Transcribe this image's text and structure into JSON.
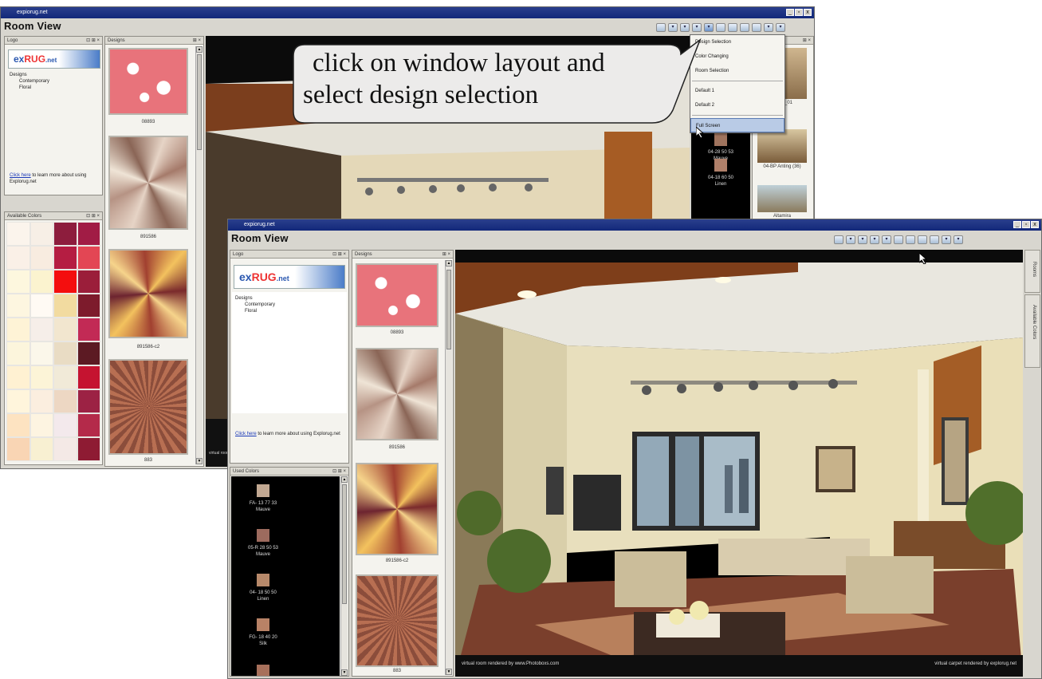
{
  "callout": {
    "line1": "click on window layout and",
    "line2": "select design selection"
  },
  "back_window": {
    "title": "expiorug.net",
    "app_title": "Room View",
    "logo_panel_title": "Logo",
    "designs_panel_title": "Designs",
    "colors_panel_title": "Available Colors",
    "tree": [
      "Designs",
      "Contemporary",
      "Floral"
    ],
    "link_prefix": "Click here",
    "link_text": " to learn more about using Explorug.net",
    "design_captions": [
      "08893",
      "891586",
      "891586-c2",
      "883"
    ],
    "menu_items": [
      "Design Selection",
      "Color Changing",
      "Room Selection",
      "Default 1",
      "Default 2",
      "Full Screen"
    ],
    "menu_highlight": "Full Screen",
    "right_color_items": [
      {
        "code": "04-28 50 53",
        "name": "Mauve",
        "color": "#a0745e"
      },
      {
        "code": "04-18 60 50",
        "name": "Linen",
        "color": "#b0806a"
      }
    ],
    "room_thumbs": [
      "Room_01",
      "04-BP Anting (36)",
      "Altamira"
    ],
    "room_footer_left": "virtual room rendered by www.Photoboxs.com",
    "swatch_colors": [
      "#fbf4ec",
      "#f7efe6",
      "#8d1d3d",
      "#a11c45",
      "#faf0e7",
      "#f8ece0",
      "#b51d42",
      "#e34654",
      "#fdf7de",
      "#fbf3cf",
      "#f40e0e",
      "#9b1e3a",
      "#fdf6e0",
      "#fffaf4",
      "#f2dba0",
      "#7d1b2c",
      "#fef3d6",
      "#f6eee9",
      "#f2e6cf",
      "#c22a55",
      "#fcf5dc",
      "#fbf7ea",
      "#e9dcc4",
      "#5c1a23",
      "#fff1d2",
      "#fcf4d7",
      "#f1ead8",
      "#c51330",
      "#fff5dc",
      "#fbeedf",
      "#edd7c3",
      "#9c2244",
      "#fde3c1",
      "#fdf4e1",
      "#f3e9ec",
      "#b42a4a",
      "#f9d5b4",
      "#f8f0d2",
      "#f4e9e6",
      "#8e1b33"
    ]
  },
  "front_window": {
    "title": "expiorug.net",
    "app_title": "Room View",
    "logo_panel_title": "Logo",
    "designs_panel_title": "Designs",
    "colors_panel_title": "Used Colors",
    "tree": [
      "Designs",
      "Contemporary",
      "Floral"
    ],
    "link_prefix": "Click here",
    "link_text": " to learn more about using Explorug.net",
    "design_captions": [
      "08893",
      "891586",
      "891586-c2",
      "883"
    ],
    "used_colors": [
      {
        "code": "FA- 13 77 33",
        "name": "Mauve",
        "color": "#c2a892"
      },
      {
        "code": "05-R 28 50 53",
        "name": "Mauve",
        "color": "#9d6b5e"
      },
      {
        "code": "04- 18 50 50",
        "name": "Linen",
        "color": "#b7896a"
      },
      {
        "code": "FG- 18 40 20",
        "name": "Silk",
        "color": "#b88266"
      }
    ],
    "side_tabs": [
      "Rooms",
      "Available Colors"
    ],
    "room_footer_left": "virtual room rendered by www.Photoboxs.com",
    "room_footer_right": "virtual carpet rendered by explorug.net"
  },
  "icons": [
    "window-layout-icon",
    "minimize-icon",
    "restore-icon",
    "close-icon"
  ]
}
